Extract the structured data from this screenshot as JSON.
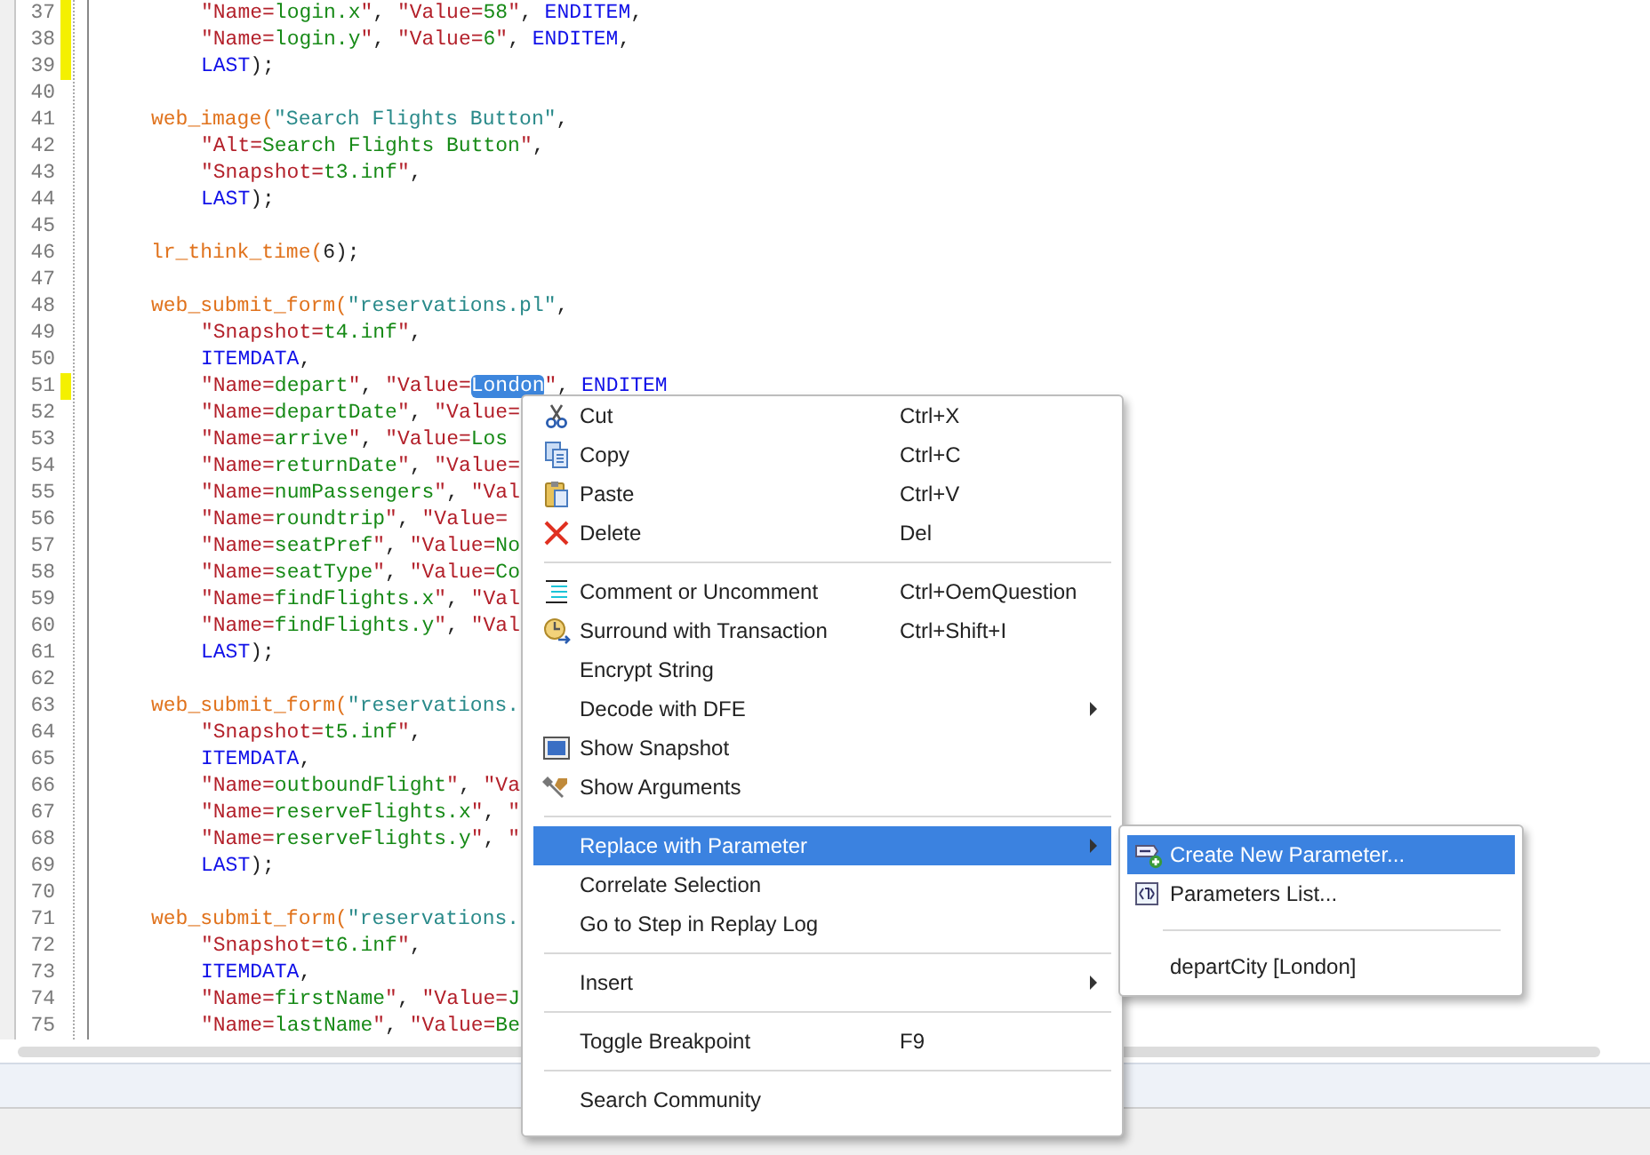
{
  "editor": {
    "lines": [
      {
        "number": "37",
        "kind": "arg",
        "modified": true,
        "tokens": [
          {
            "kind": "q",
            "text": "\"Name="
          },
          {
            "kind": "v",
            "text": "login.x"
          },
          {
            "kind": "q",
            "text": "\""
          },
          {
            "kind": "p",
            "text": ", "
          },
          {
            "kind": "q",
            "text": "\"Value="
          },
          {
            "kind": "v",
            "text": "58"
          },
          {
            "kind": "q",
            "text": "\""
          },
          {
            "kind": "p",
            "text": ", "
          },
          {
            "kind": "k",
            "text": "ENDITEM"
          },
          {
            "kind": "p",
            "text": ","
          }
        ]
      },
      {
        "number": "38",
        "kind": "arg",
        "modified": true,
        "tokens": [
          {
            "kind": "q",
            "text": "\"Name="
          },
          {
            "kind": "v",
            "text": "login.y"
          },
          {
            "kind": "q",
            "text": "\""
          },
          {
            "kind": "p",
            "text": ", "
          },
          {
            "kind": "q",
            "text": "\"Value="
          },
          {
            "kind": "v",
            "text": "6"
          },
          {
            "kind": "q",
            "text": "\""
          },
          {
            "kind": "p",
            "text": ", "
          },
          {
            "kind": "k",
            "text": "ENDITEM"
          },
          {
            "kind": "p",
            "text": ","
          }
        ]
      },
      {
        "number": "39",
        "kind": "arg",
        "modified": true,
        "tokens": [
          {
            "kind": "k",
            "text": "LAST"
          },
          {
            "kind": "p",
            "text": ");"
          }
        ]
      },
      {
        "number": "40",
        "kind": "blank",
        "modified": false
      },
      {
        "number": "41",
        "kind": "call",
        "modified": false,
        "tokens": [
          {
            "kind": "f",
            "text": "web_image("
          },
          {
            "kind": "s",
            "text": "\"Search Flights Button\""
          },
          {
            "kind": "p",
            "text": ","
          }
        ]
      },
      {
        "number": "42",
        "kind": "arg",
        "modified": false,
        "tokens": [
          {
            "kind": "q",
            "text": "\"Alt="
          },
          {
            "kind": "v",
            "text": "Search Flights Button"
          },
          {
            "kind": "q",
            "text": "\""
          },
          {
            "kind": "p",
            "text": ","
          }
        ]
      },
      {
        "number": "43",
        "kind": "arg",
        "modified": false,
        "tokens": [
          {
            "kind": "q",
            "text": "\"Snapshot="
          },
          {
            "kind": "v",
            "text": "t3.inf"
          },
          {
            "kind": "q",
            "text": "\""
          },
          {
            "kind": "p",
            "text": ","
          }
        ]
      },
      {
        "number": "44",
        "kind": "arg",
        "modified": false,
        "tokens": [
          {
            "kind": "k",
            "text": "LAST"
          },
          {
            "kind": "p",
            "text": ");"
          }
        ]
      },
      {
        "number": "45",
        "kind": "blank",
        "modified": false
      },
      {
        "number": "46",
        "kind": "call",
        "modified": false,
        "tokens": [
          {
            "kind": "f",
            "text": "lr_think_time("
          },
          {
            "kind": "p",
            "text": "6);"
          }
        ]
      },
      {
        "number": "47",
        "kind": "blank",
        "modified": false
      },
      {
        "number": "48",
        "kind": "call",
        "modified": false,
        "tokens": [
          {
            "kind": "f",
            "text": "web_submit_form("
          },
          {
            "kind": "s",
            "text": "\"reservations.pl\""
          },
          {
            "kind": "p",
            "text": ","
          }
        ]
      },
      {
        "number": "49",
        "kind": "arg",
        "modified": false,
        "tokens": [
          {
            "kind": "q",
            "text": "\"Snapshot="
          },
          {
            "kind": "v",
            "text": "t4.inf"
          },
          {
            "kind": "q",
            "text": "\""
          },
          {
            "kind": "p",
            "text": ","
          }
        ]
      },
      {
        "number": "50",
        "kind": "arg",
        "modified": false,
        "tokens": [
          {
            "kind": "k",
            "text": "ITEMDATA"
          },
          {
            "kind": "p",
            "text": ","
          }
        ]
      },
      {
        "number": "51",
        "kind": "arg",
        "modified": true,
        "tokens": [
          {
            "kind": "q",
            "text": "\"Name="
          },
          {
            "kind": "v",
            "text": "depart"
          },
          {
            "kind": "q",
            "text": "\""
          },
          {
            "kind": "p",
            "text": ", "
          },
          {
            "kind": "q",
            "text": "\"Value="
          },
          {
            "kind": "sel",
            "text": "London"
          },
          {
            "kind": "q",
            "text": "\""
          },
          {
            "kind": "p",
            "text": ", "
          },
          {
            "kind": "k",
            "text": "ENDITEM"
          }
        ]
      },
      {
        "number": "52",
        "kind": "arg",
        "modified": false,
        "tokens": [
          {
            "kind": "q",
            "text": "\"Name="
          },
          {
            "kind": "v",
            "text": "departDate"
          },
          {
            "kind": "q",
            "text": "\""
          },
          {
            "kind": "p",
            "text": ", "
          },
          {
            "kind": "q",
            "text": "\"Value="
          }
        ]
      },
      {
        "number": "53",
        "kind": "arg",
        "modified": false,
        "tokens": [
          {
            "kind": "q",
            "text": "\"Name="
          },
          {
            "kind": "v",
            "text": "arrive"
          },
          {
            "kind": "q",
            "text": "\""
          },
          {
            "kind": "p",
            "text": ", "
          },
          {
            "kind": "q",
            "text": "\"Value="
          },
          {
            "kind": "v",
            "text": "Los"
          }
        ]
      },
      {
        "number": "54",
        "kind": "arg",
        "modified": false,
        "tokens": [
          {
            "kind": "q",
            "text": "\"Name="
          },
          {
            "kind": "v",
            "text": "returnDate"
          },
          {
            "kind": "q",
            "text": "\""
          },
          {
            "kind": "p",
            "text": ", "
          },
          {
            "kind": "q",
            "text": "\"Value="
          }
        ]
      },
      {
        "number": "55",
        "kind": "arg",
        "modified": false,
        "tokens": [
          {
            "kind": "q",
            "text": "\"Name="
          },
          {
            "kind": "v",
            "text": "numPassengers"
          },
          {
            "kind": "q",
            "text": "\""
          },
          {
            "kind": "p",
            "text": ", "
          },
          {
            "kind": "q",
            "text": "\"Val"
          }
        ]
      },
      {
        "number": "56",
        "kind": "arg",
        "modified": false,
        "tokens": [
          {
            "kind": "q",
            "text": "\"Name="
          },
          {
            "kind": "v",
            "text": "roundtrip"
          },
          {
            "kind": "q",
            "text": "\""
          },
          {
            "kind": "p",
            "text": ", "
          },
          {
            "kind": "q",
            "text": "\"Value="
          }
        ]
      },
      {
        "number": "57",
        "kind": "arg",
        "modified": false,
        "tokens": [
          {
            "kind": "q",
            "text": "\"Name="
          },
          {
            "kind": "v",
            "text": "seatPref"
          },
          {
            "kind": "q",
            "text": "\""
          },
          {
            "kind": "p",
            "text": ", "
          },
          {
            "kind": "q",
            "text": "\"Value="
          },
          {
            "kind": "v",
            "text": "No"
          }
        ]
      },
      {
        "number": "58",
        "kind": "arg",
        "modified": false,
        "tokens": [
          {
            "kind": "q",
            "text": "\"Name="
          },
          {
            "kind": "v",
            "text": "seatType"
          },
          {
            "kind": "q",
            "text": "\""
          },
          {
            "kind": "p",
            "text": ", "
          },
          {
            "kind": "q",
            "text": "\"Value="
          },
          {
            "kind": "v",
            "text": "Co"
          }
        ]
      },
      {
        "number": "59",
        "kind": "arg",
        "modified": false,
        "tokens": [
          {
            "kind": "q",
            "text": "\"Name="
          },
          {
            "kind": "v",
            "text": "findFlights.x"
          },
          {
            "kind": "q",
            "text": "\""
          },
          {
            "kind": "p",
            "text": ", "
          },
          {
            "kind": "q",
            "text": "\"Val"
          }
        ]
      },
      {
        "number": "60",
        "kind": "arg",
        "modified": false,
        "tokens": [
          {
            "kind": "q",
            "text": "\"Name="
          },
          {
            "kind": "v",
            "text": "findFlights.y"
          },
          {
            "kind": "q",
            "text": "\""
          },
          {
            "kind": "p",
            "text": ", "
          },
          {
            "kind": "q",
            "text": "\"Val"
          }
        ]
      },
      {
        "number": "61",
        "kind": "arg",
        "modified": false,
        "tokens": [
          {
            "kind": "k",
            "text": "LAST"
          },
          {
            "kind": "p",
            "text": ");"
          }
        ]
      },
      {
        "number": "62",
        "kind": "blank",
        "modified": false
      },
      {
        "number": "63",
        "kind": "call",
        "modified": false,
        "tokens": [
          {
            "kind": "f",
            "text": "web_submit_form("
          },
          {
            "kind": "s",
            "text": "\"reservations."
          }
        ]
      },
      {
        "number": "64",
        "kind": "arg",
        "modified": false,
        "tokens": [
          {
            "kind": "q",
            "text": "\"Snapshot="
          },
          {
            "kind": "v",
            "text": "t5.inf"
          },
          {
            "kind": "q",
            "text": "\""
          },
          {
            "kind": "p",
            "text": ","
          }
        ]
      },
      {
        "number": "65",
        "kind": "arg",
        "modified": false,
        "tokens": [
          {
            "kind": "k",
            "text": "ITEMDATA"
          },
          {
            "kind": "p",
            "text": ","
          }
        ]
      },
      {
        "number": "66",
        "kind": "arg",
        "modified": false,
        "tokens": [
          {
            "kind": "q",
            "text": "\"Name="
          },
          {
            "kind": "v",
            "text": "outboundFlight"
          },
          {
            "kind": "q",
            "text": "\""
          },
          {
            "kind": "p",
            "text": ", "
          },
          {
            "kind": "q",
            "text": "\"Va"
          }
        ]
      },
      {
        "number": "67",
        "kind": "arg",
        "modified": false,
        "tokens": [
          {
            "kind": "q",
            "text": "\"Name="
          },
          {
            "kind": "v",
            "text": "reserveFlights.x"
          },
          {
            "kind": "q",
            "text": "\""
          },
          {
            "kind": "p",
            "text": ", "
          },
          {
            "kind": "q",
            "text": "\""
          }
        ]
      },
      {
        "number": "68",
        "kind": "arg",
        "modified": false,
        "tokens": [
          {
            "kind": "q",
            "text": "\"Name="
          },
          {
            "kind": "v",
            "text": "reserveFlights.y"
          },
          {
            "kind": "q",
            "text": "\""
          },
          {
            "kind": "p",
            "text": ", "
          },
          {
            "kind": "q",
            "text": "\""
          }
        ]
      },
      {
        "number": "69",
        "kind": "arg",
        "modified": false,
        "tokens": [
          {
            "kind": "k",
            "text": "LAST"
          },
          {
            "kind": "p",
            "text": ");"
          }
        ]
      },
      {
        "number": "70",
        "kind": "blank",
        "modified": false
      },
      {
        "number": "71",
        "kind": "call",
        "modified": false,
        "tokens": [
          {
            "kind": "f",
            "text": "web_submit_form("
          },
          {
            "kind": "s",
            "text": "\"reservations."
          }
        ]
      },
      {
        "number": "72",
        "kind": "arg",
        "modified": false,
        "tokens": [
          {
            "kind": "q",
            "text": "\"Snapshot="
          },
          {
            "kind": "v",
            "text": "t6.inf"
          },
          {
            "kind": "q",
            "text": "\""
          },
          {
            "kind": "p",
            "text": ","
          }
        ]
      },
      {
        "number": "73",
        "kind": "arg",
        "modified": false,
        "tokens": [
          {
            "kind": "k",
            "text": "ITEMDATA"
          },
          {
            "kind": "p",
            "text": ","
          }
        ]
      },
      {
        "number": "74",
        "kind": "arg",
        "modified": false,
        "tokens": [
          {
            "kind": "q",
            "text": "\"Name="
          },
          {
            "kind": "v",
            "text": "firstName"
          },
          {
            "kind": "q",
            "text": "\""
          },
          {
            "kind": "p",
            "text": ", "
          },
          {
            "kind": "q",
            "text": "\"Value="
          },
          {
            "kind": "v",
            "text": "J"
          }
        ]
      },
      {
        "number": "75",
        "kind": "arg",
        "modified": false,
        "tokens": [
          {
            "kind": "q",
            "text": "\"Name="
          },
          {
            "kind": "v",
            "text": "lastName"
          },
          {
            "kind": "q",
            "text": "\""
          },
          {
            "kind": "p",
            "text": ", "
          },
          {
            "kind": "q",
            "text": "\"Value="
          },
          {
            "kind": "v",
            "text": "Be"
          }
        ]
      }
    ]
  },
  "context_menu": {
    "items": [
      {
        "kind": "item",
        "label": "Cut",
        "shortcut": "Ctrl+X",
        "selected": false
      },
      {
        "kind": "item",
        "label": "Copy",
        "shortcut": "Ctrl+C",
        "selected": false
      },
      {
        "kind": "item",
        "label": "Paste",
        "shortcut": "Ctrl+V",
        "selected": false
      },
      {
        "kind": "item",
        "label": "Delete",
        "shortcut": "Del",
        "selected": false
      },
      {
        "kind": "separator"
      },
      {
        "kind": "item",
        "label": "Comment or Uncomment",
        "shortcut": "Ctrl+OemQuestion",
        "selected": false
      },
      {
        "kind": "item",
        "label": "Surround with Transaction",
        "shortcut": "Ctrl+Shift+I",
        "selected": false
      },
      {
        "kind": "item",
        "label": "Encrypt String",
        "selected": false
      },
      {
        "kind": "item",
        "label": "Decode with DFE",
        "has_submenu": true,
        "selected": false
      },
      {
        "kind": "item",
        "label": "Show Snapshot",
        "selected": false
      },
      {
        "kind": "item",
        "label": "Show Arguments",
        "selected": false
      },
      {
        "kind": "separator"
      },
      {
        "kind": "item",
        "label": "Replace with Parameter",
        "has_submenu": true,
        "selected": true,
        "submenu": {
          "items": [
            {
              "kind": "item",
              "label": "Create New Parameter...",
              "selected": true
            },
            {
              "kind": "item",
              "label": "Parameters List...",
              "selected": false
            },
            {
              "kind": "separator"
            },
            {
              "kind": "item",
              "label": "departCity [London]",
              "selected": false
            }
          ]
        }
      },
      {
        "kind": "item",
        "label": "Correlate Selection",
        "selected": false
      },
      {
        "kind": "item",
        "label": "Go to Step in Replay Log",
        "selected": false
      },
      {
        "kind": "separator"
      },
      {
        "kind": "item",
        "label": "Insert",
        "has_submenu": true,
        "selected": false
      },
      {
        "kind": "separator"
      },
      {
        "kind": "item",
        "label": "Toggle Breakpoint",
        "shortcut": "F9",
        "selected": false
      },
      {
        "kind": "separator"
      },
      {
        "kind": "item",
        "label": "Search Community",
        "selected": false
      }
    ]
  }
}
